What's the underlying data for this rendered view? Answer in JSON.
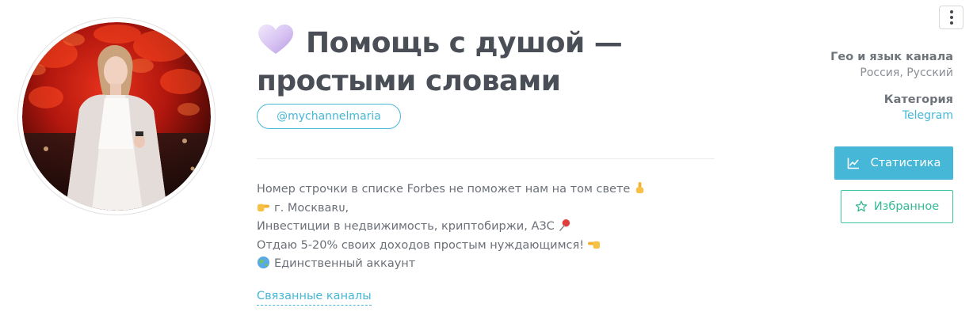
{
  "channel": {
    "title": "Помощь с душой — простыми словами",
    "title_emoji_icon": "purple-heart-icon",
    "handle": "@mychannelmaria",
    "description": [
      {
        "pre_icon": null,
        "text": "Номер строчки в списке Forbes не поможет нам на том свете",
        "post_icon": "pointing-up-hand-icon"
      },
      {
        "pre_icon": "pointing-right-hand-icon",
        "text": "г. Москваʀᴜ,",
        "post_icon": null
      },
      {
        "pre_icon": null,
        "text": "Инвестиции в недвижимость, криптобиржи, АЗС",
        "post_icon": "pushpin-icon"
      },
      {
        "pre_icon": null,
        "text": "Отдаю 5-20% своих доходов простым нуждающимся!",
        "post_icon": "pointing-left-hand-icon"
      },
      {
        "pre_icon": "globe-icon",
        "text": "Единственный аккаунт",
        "post_icon": null
      }
    ],
    "related_channels_label": "Связанные каналы"
  },
  "meta": {
    "geo_label": "Гео и язык канала",
    "geo_value": "Россия, Русский",
    "category_label": "Категория",
    "category_value": "Telegram"
  },
  "actions": {
    "stats_label": "Статистика",
    "stats_icon": "line-chart-icon",
    "favorite_label": "Избранное",
    "favorite_icon": "star-outline-icon",
    "menu_icon": "vertical-dots-icon"
  },
  "colors": {
    "accent": "#46b7d7",
    "favorite": "#3ec4a0",
    "title_text": "#4a4f57",
    "body_text": "#6b7078",
    "muted_text": "#8a8f96"
  }
}
